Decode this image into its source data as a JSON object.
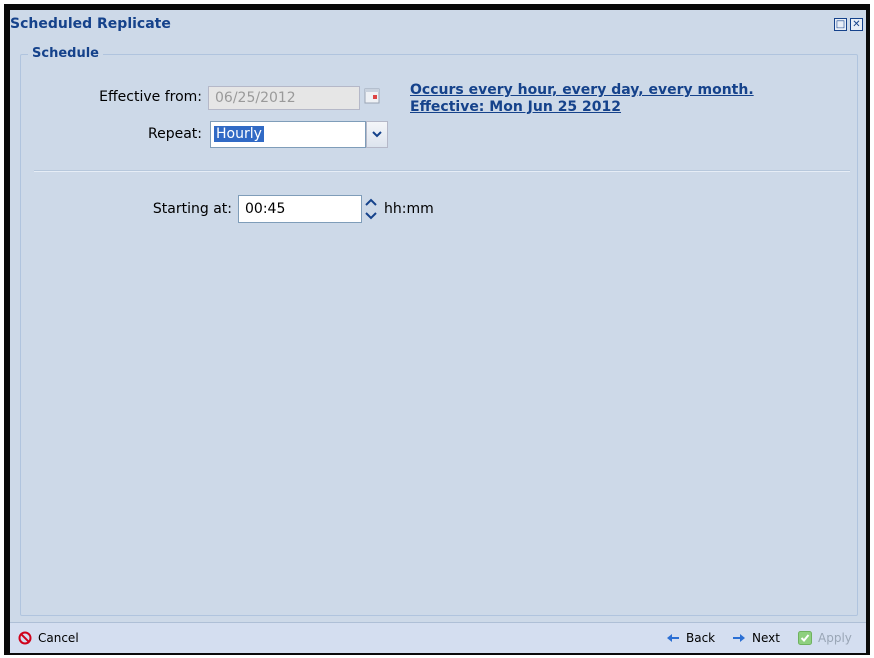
{
  "window": {
    "title": "Scheduled Replicate"
  },
  "titlebar": {
    "maximize_icon": "maximize-icon",
    "close_icon": "close-icon"
  },
  "schedule": {
    "legend": "Schedule",
    "effective_from_label": "Effective from:",
    "effective_from_value": "06/25/2012",
    "repeat_label": "Repeat:",
    "repeat_value": "Hourly",
    "summary_line1": "Occurs every hour, every day, every month.",
    "summary_line2": "Effective: Mon Jun 25 2012",
    "starting_at_label": "Starting at:",
    "starting_at_value": "00:45",
    "time_format": "hh:mm"
  },
  "footer": {
    "cancel_label": "Cancel",
    "back_label": "Back",
    "next_label": "Next",
    "apply_label": "Apply"
  },
  "colors": {
    "panel_bg": "#cdd9e8",
    "title_color": "#15428b",
    "cancel_icon_color": "#d0021b"
  }
}
